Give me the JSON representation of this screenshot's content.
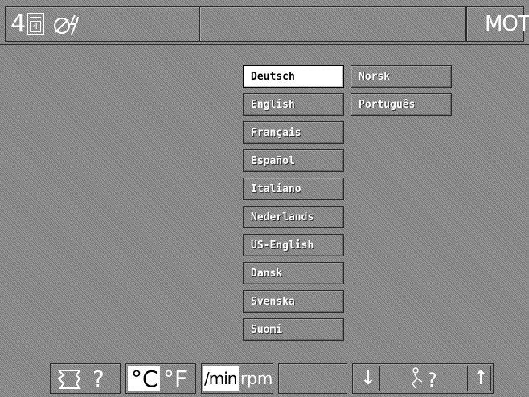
{
  "header": {
    "channel_number": "4",
    "window_number": "4",
    "mode_label": "MOT"
  },
  "languages_left": [
    {
      "label": "Deutsch",
      "selected": true
    },
    {
      "label": "English",
      "selected": false
    },
    {
      "label": "Français",
      "selected": false
    },
    {
      "label": "Español",
      "selected": false
    },
    {
      "label": "Italiano",
      "selected": false
    },
    {
      "label": "Nederlands",
      "selected": false
    },
    {
      "label": "US-English",
      "selected": false
    },
    {
      "label": "Dansk",
      "selected": false
    },
    {
      "label": "Svenska",
      "selected": false
    },
    {
      "label": "Suomi",
      "selected": false
    }
  ],
  "languages_right": [
    {
      "label": "Norsk",
      "selected": false
    },
    {
      "label": "Português",
      "selected": false
    }
  ],
  "footer": {
    "help_symbol": "?",
    "celsius_label": "°C",
    "fahrenheit_label": "°F",
    "per_min_label": "/min",
    "rpm_label": "rpm",
    "nav_help_symbol": "?",
    "arrow_down": "↓",
    "arrow_up": "↑"
  },
  "colors": {
    "background": "#8a8a8a",
    "border": "#2a2a2a",
    "selected_bg": "#ffffff",
    "text": "#ffffff"
  }
}
